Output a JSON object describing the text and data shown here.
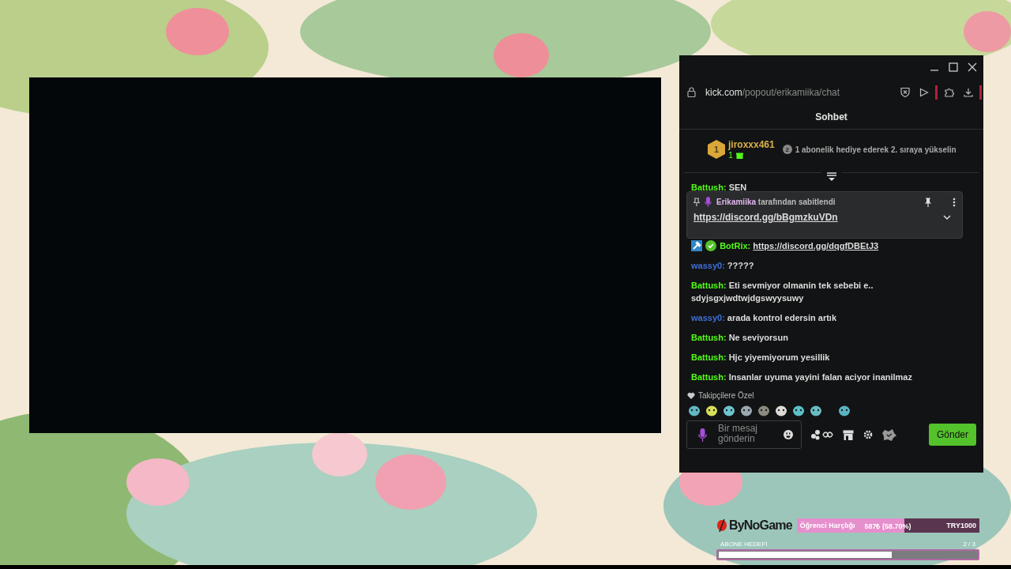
{
  "browser": {
    "url_host": "kick.com",
    "url_path": "/popout/erikamiika/chat"
  },
  "chat_title": "Sohbet",
  "leaderboard": {
    "rank": "1",
    "user": "jiroxxx461",
    "count": "1",
    "next_rank": "2",
    "prompt": "1 abonelik hediye ederek 2. sıraya yükselin"
  },
  "hidden_message": {
    "user": "Battush:",
    "text": "SEN",
    "color": "#53fc18"
  },
  "pinned": {
    "user": "Erikamiika",
    "suffix": "tarafından sabitlendi",
    "link": "https://discord.gg/bBgmzkuVDn"
  },
  "messages": [
    {
      "kind": "bot",
      "user": "BotRix:",
      "color": "#53fc18",
      "text": "https://discord.gg/dqgfDBEtJ3"
    },
    {
      "kind": "text",
      "user": "wassy0:",
      "color": "#3f6fd8",
      "text": "?????"
    },
    {
      "kind": "text",
      "user": "Battush:",
      "color": "#53fc18",
      "text": "Eti sevmiyor olmanin tek sebebi e.. sdyjsgxjwdtwjdgswyysuwy"
    },
    {
      "kind": "text",
      "user": "wassy0:",
      "color": "#3f6fd8",
      "text": "arada kontrol edersin artık"
    },
    {
      "kind": "text",
      "user": "Battush:",
      "color": "#53fc18",
      "text": "Ne seviyorsun"
    },
    {
      "kind": "text",
      "user": "Battush:",
      "color": "#53fc18",
      "text": "Hjc yiyemiyorum yesillik"
    },
    {
      "kind": "text",
      "user": "Battush:",
      "color": "#53fc18",
      "text": "Insanlar uyuma yayini falan aciyor inanilmaz"
    }
  ],
  "emotes": {
    "label": "Takipçilere Özel"
  },
  "composer": {
    "placeholder": "Bir mesaj gönderin",
    "send": "Gönder"
  },
  "donation_goal": {
    "brand": "ByNoGame",
    "label": "Öğrenci Harçlığı",
    "amount": "587₺ (58.70%)",
    "level": 0.587,
    "target": "TRY1000"
  },
  "sub_goal": {
    "label": "ABONE HEDEFİ",
    "count": "2 / 3",
    "level": 0.67
  }
}
